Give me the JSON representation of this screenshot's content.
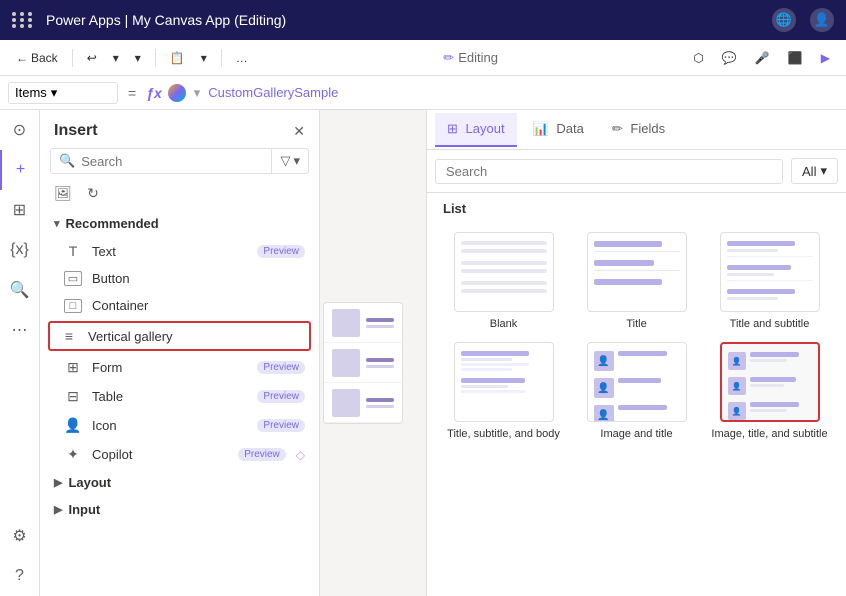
{
  "app": {
    "top_bar": {
      "title": "Power Apps | My Canvas App (Editing)",
      "app_name": "Power Apps",
      "separator": "|",
      "doc_name": "My Canvas App (Editing)"
    },
    "toolbar": {
      "back_label": "Back",
      "undo_label": "↩",
      "redo_label": "↪",
      "paste_label": "📋",
      "more_label": "…",
      "editing_label": "Editing",
      "toolbar_icons": [
        "share-icon",
        "chat-icon",
        "mic-icon",
        "export-icon",
        "play-icon"
      ]
    },
    "formula_bar": {
      "dropdown_label": "Items",
      "eq": "=",
      "fx": "ƒx",
      "value": "CustomGallerySample"
    },
    "insert_panel": {
      "title": "Insert",
      "search_placeholder": "Search",
      "recommended_label": "Recommended",
      "items": [
        {
          "icon": "T",
          "label": "Text",
          "badge": "Preview"
        },
        {
          "icon": "▭",
          "label": "Button",
          "badge": null
        },
        {
          "icon": "□",
          "label": "Container",
          "badge": null
        },
        {
          "icon": "≡",
          "label": "Vertical gallery",
          "badge": null,
          "highlighted": true
        },
        {
          "icon": "⊞",
          "label": "Form",
          "badge": "Preview"
        },
        {
          "icon": "⊟",
          "label": "Table",
          "badge": "Preview"
        },
        {
          "icon": "👤",
          "label": "Icon",
          "badge": "Preview"
        },
        {
          "icon": "✦",
          "label": "Copilot",
          "badge": "Preview",
          "has_diamond": true
        }
      ],
      "layout_section": {
        "label": "Layout",
        "expanded": false
      },
      "input_section": {
        "label": "Input",
        "expanded": false
      }
    },
    "properties_panel": {
      "tabs": [
        {
          "label": "Layout",
          "icon": "⊞",
          "active": true
        },
        {
          "label": "Data",
          "icon": "📊",
          "active": false
        },
        {
          "label": "Fields",
          "icon": "✏",
          "active": false
        }
      ],
      "search_placeholder": "Search",
      "filter_all_label": "All",
      "list_label": "List",
      "layout_items": [
        {
          "id": "blank",
          "label": "Blank"
        },
        {
          "id": "title",
          "label": "Title"
        },
        {
          "id": "title-subtitle",
          "label": "Title and subtitle"
        },
        {
          "id": "title-subtitle-body",
          "label": "Title, subtitle, and body"
        },
        {
          "id": "image-title",
          "label": "Image and title"
        },
        {
          "id": "image-title-subtitle",
          "label": "Image, title, and subtitle",
          "selected": true
        }
      ]
    }
  }
}
